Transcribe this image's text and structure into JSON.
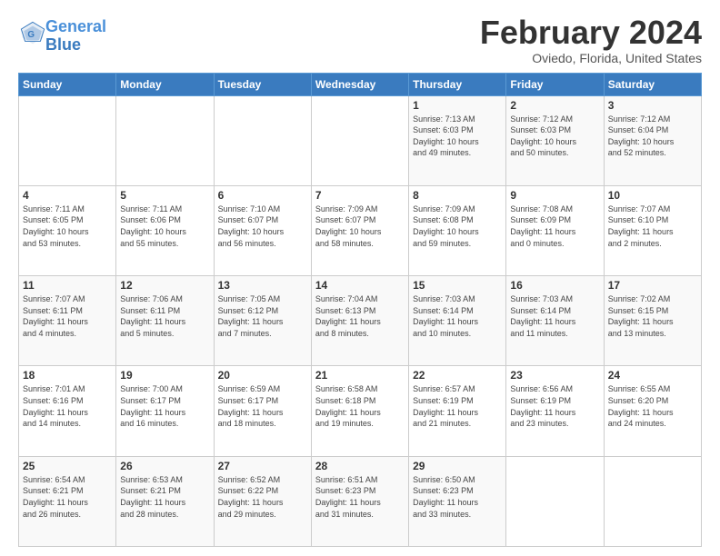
{
  "header": {
    "logo_general": "General",
    "logo_blue": "Blue",
    "month_title": "February 2024",
    "location": "Oviedo, Florida, United States"
  },
  "days_of_week": [
    "Sunday",
    "Monday",
    "Tuesday",
    "Wednesday",
    "Thursday",
    "Friday",
    "Saturday"
  ],
  "weeks": [
    [
      {
        "day": "",
        "info": ""
      },
      {
        "day": "",
        "info": ""
      },
      {
        "day": "",
        "info": ""
      },
      {
        "day": "",
        "info": ""
      },
      {
        "day": "1",
        "info": "Sunrise: 7:13 AM\nSunset: 6:03 PM\nDaylight: 10 hours\nand 49 minutes."
      },
      {
        "day": "2",
        "info": "Sunrise: 7:12 AM\nSunset: 6:03 PM\nDaylight: 10 hours\nand 50 minutes."
      },
      {
        "day": "3",
        "info": "Sunrise: 7:12 AM\nSunset: 6:04 PM\nDaylight: 10 hours\nand 52 minutes."
      }
    ],
    [
      {
        "day": "4",
        "info": "Sunrise: 7:11 AM\nSunset: 6:05 PM\nDaylight: 10 hours\nand 53 minutes."
      },
      {
        "day": "5",
        "info": "Sunrise: 7:11 AM\nSunset: 6:06 PM\nDaylight: 10 hours\nand 55 minutes."
      },
      {
        "day": "6",
        "info": "Sunrise: 7:10 AM\nSunset: 6:07 PM\nDaylight: 10 hours\nand 56 minutes."
      },
      {
        "day": "7",
        "info": "Sunrise: 7:09 AM\nSunset: 6:07 PM\nDaylight: 10 hours\nand 58 minutes."
      },
      {
        "day": "8",
        "info": "Sunrise: 7:09 AM\nSunset: 6:08 PM\nDaylight: 10 hours\nand 59 minutes."
      },
      {
        "day": "9",
        "info": "Sunrise: 7:08 AM\nSunset: 6:09 PM\nDaylight: 11 hours\nand 0 minutes."
      },
      {
        "day": "10",
        "info": "Sunrise: 7:07 AM\nSunset: 6:10 PM\nDaylight: 11 hours\nand 2 minutes."
      }
    ],
    [
      {
        "day": "11",
        "info": "Sunrise: 7:07 AM\nSunset: 6:11 PM\nDaylight: 11 hours\nand 4 minutes."
      },
      {
        "day": "12",
        "info": "Sunrise: 7:06 AM\nSunset: 6:11 PM\nDaylight: 11 hours\nand 5 minutes."
      },
      {
        "day": "13",
        "info": "Sunrise: 7:05 AM\nSunset: 6:12 PM\nDaylight: 11 hours\nand 7 minutes."
      },
      {
        "day": "14",
        "info": "Sunrise: 7:04 AM\nSunset: 6:13 PM\nDaylight: 11 hours\nand 8 minutes."
      },
      {
        "day": "15",
        "info": "Sunrise: 7:03 AM\nSunset: 6:14 PM\nDaylight: 11 hours\nand 10 minutes."
      },
      {
        "day": "16",
        "info": "Sunrise: 7:03 AM\nSunset: 6:14 PM\nDaylight: 11 hours\nand 11 minutes."
      },
      {
        "day": "17",
        "info": "Sunrise: 7:02 AM\nSunset: 6:15 PM\nDaylight: 11 hours\nand 13 minutes."
      }
    ],
    [
      {
        "day": "18",
        "info": "Sunrise: 7:01 AM\nSunset: 6:16 PM\nDaylight: 11 hours\nand 14 minutes."
      },
      {
        "day": "19",
        "info": "Sunrise: 7:00 AM\nSunset: 6:17 PM\nDaylight: 11 hours\nand 16 minutes."
      },
      {
        "day": "20",
        "info": "Sunrise: 6:59 AM\nSunset: 6:17 PM\nDaylight: 11 hours\nand 18 minutes."
      },
      {
        "day": "21",
        "info": "Sunrise: 6:58 AM\nSunset: 6:18 PM\nDaylight: 11 hours\nand 19 minutes."
      },
      {
        "day": "22",
        "info": "Sunrise: 6:57 AM\nSunset: 6:19 PM\nDaylight: 11 hours\nand 21 minutes."
      },
      {
        "day": "23",
        "info": "Sunrise: 6:56 AM\nSunset: 6:19 PM\nDaylight: 11 hours\nand 23 minutes."
      },
      {
        "day": "24",
        "info": "Sunrise: 6:55 AM\nSunset: 6:20 PM\nDaylight: 11 hours\nand 24 minutes."
      }
    ],
    [
      {
        "day": "25",
        "info": "Sunrise: 6:54 AM\nSunset: 6:21 PM\nDaylight: 11 hours\nand 26 minutes."
      },
      {
        "day": "26",
        "info": "Sunrise: 6:53 AM\nSunset: 6:21 PM\nDaylight: 11 hours\nand 28 minutes."
      },
      {
        "day": "27",
        "info": "Sunrise: 6:52 AM\nSunset: 6:22 PM\nDaylight: 11 hours\nand 29 minutes."
      },
      {
        "day": "28",
        "info": "Sunrise: 6:51 AM\nSunset: 6:23 PM\nDaylight: 11 hours\nand 31 minutes."
      },
      {
        "day": "29",
        "info": "Sunrise: 6:50 AM\nSunset: 6:23 PM\nDaylight: 11 hours\nand 33 minutes."
      },
      {
        "day": "",
        "info": ""
      },
      {
        "day": "",
        "info": ""
      }
    ]
  ]
}
